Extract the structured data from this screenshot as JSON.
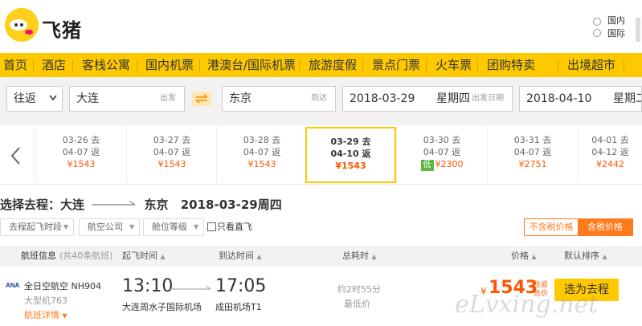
{
  "brand": {
    "name": "飞猪"
  },
  "top_right": {
    "line1": "国内",
    "line2": "国际"
  },
  "nav": [
    "首页",
    "酒店",
    "客栈公寓",
    "国内机票",
    "港澳台/国际机票",
    "旅游度假",
    "景点门票",
    "火车票",
    "团购特卖",
    "出境超市"
  ],
  "search": {
    "trip_type": "往返",
    "from_city": "大连",
    "from_hint": "出发",
    "to_city": "东京",
    "to_hint": "到达",
    "depart_date": "2018-03-29",
    "depart_weekday": "星期四",
    "depart_hint": "出发日期",
    "return_date": "2018-04-10",
    "return_weekday": "星期二"
  },
  "dates": [
    {
      "go": "03-26 去",
      "ret": "04-07 返",
      "price": "¥1543",
      "low": ""
    },
    {
      "go": "03-27 去",
      "ret": "04-07 返",
      "price": "¥1543",
      "low": ""
    },
    {
      "go": "03-28 去",
      "ret": "04-07 返",
      "price": "¥1543",
      "low": ""
    },
    {
      "go": "03-29 去",
      "ret": "04-10 返",
      "price": "¥1543",
      "low": ""
    },
    {
      "go": "03-30 去",
      "ret": "04-07 返",
      "price": "¥2300",
      "low": "低"
    },
    {
      "go": "03-31 去",
      "ret": "04-07 返",
      "price": "¥2751",
      "low": ""
    },
    {
      "go": "04-01 去",
      "ret": "04-12 返",
      "price": "¥2442",
      "low": ""
    }
  ],
  "route": {
    "label": "选择去程：",
    "from": "大连",
    "to": "东京",
    "date": "2018-03-29周四"
  },
  "filters": [
    "去程起飞时段",
    "航空公司",
    "舱位等级"
  ],
  "direct_only": "只看直飞",
  "tax": {
    "excl": "不含税价格",
    "incl": "含税价格"
  },
  "table_header": {
    "info": "航班信息",
    "count": "(共40条航班)",
    "depart": "起飞时间",
    "arrive": "到达时间",
    "duration": "总耗时",
    "price": "价格",
    "sort": "默认排序"
  },
  "flight": {
    "airline": "全日空航空",
    "code": "NH904",
    "aircraft": "大型机763",
    "detail": "航班详情",
    "depart_time": "13:10",
    "depart_airport": "大连周水子国际机场",
    "arrive_time": "17:05",
    "arrive_airport": "成田机场T1",
    "duration": "约2时55分",
    "lowest": "最低价",
    "currency": "¥",
    "price": "1543",
    "price_note1": "往返",
    "price_note2": "总价",
    "select": "选为去程"
  },
  "watermark": "eLvxing.net",
  "colors": {
    "brand_yellow": "#ffc900",
    "price_orange": "#ff5500",
    "low_green": "#5fb83e"
  }
}
